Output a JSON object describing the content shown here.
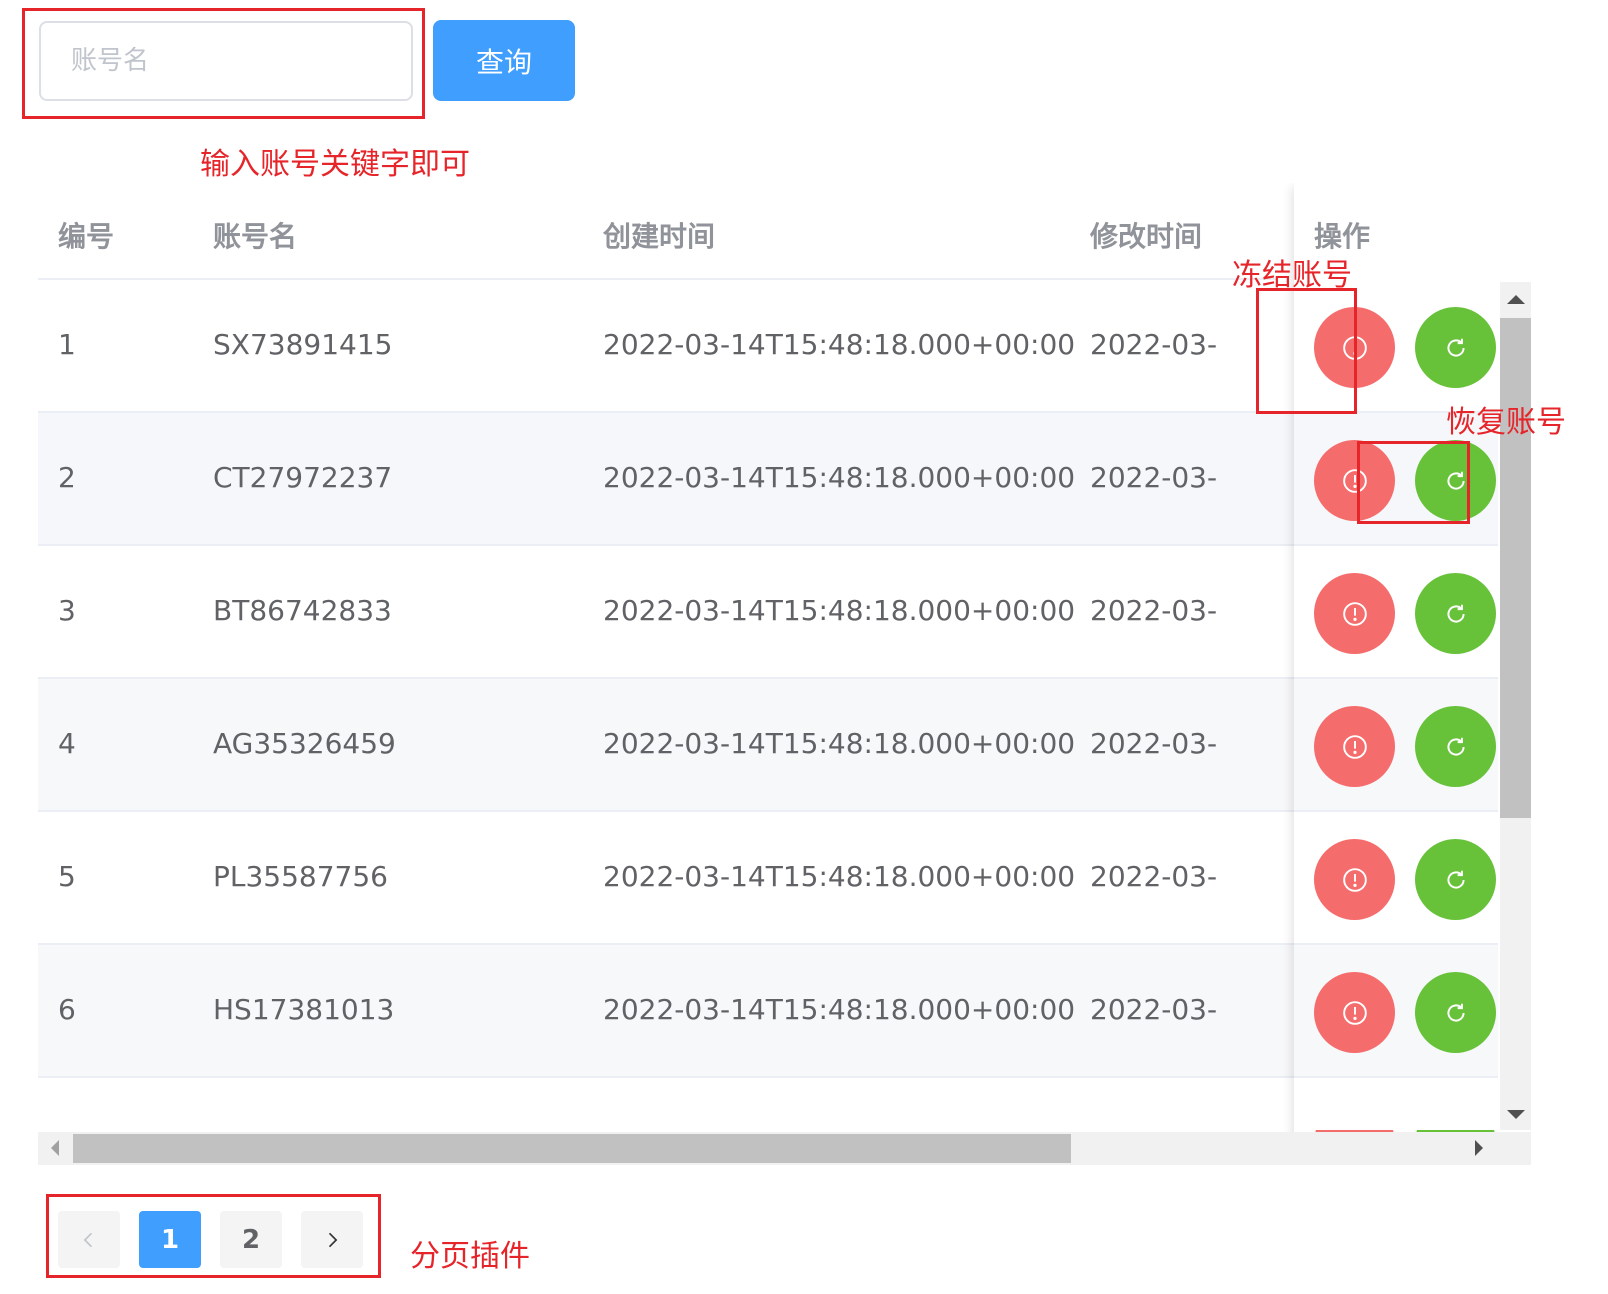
{
  "search": {
    "placeholder": "账号名",
    "value": "",
    "button_label": "查询"
  },
  "annotations": {
    "search_hint": "输入账号关键字即可",
    "freeze_hint": "冻结账号",
    "restore_hint": "恢复账号",
    "pagination_hint": "分页插件"
  },
  "table": {
    "columns": [
      "编号",
      "账号名",
      "创建时间",
      "修改时间",
      "操作"
    ],
    "rows": [
      {
        "id": "1",
        "account": "SX73891415",
        "created": "2022-03-14T15:48:18.000+00:00",
        "modified": "2022-03-"
      },
      {
        "id": "2",
        "account": "CT27972237",
        "created": "2022-03-14T15:48:18.000+00:00",
        "modified": "2022-03-"
      },
      {
        "id": "3",
        "account": "BT86742833",
        "created": "2022-03-14T15:48:18.000+00:00",
        "modified": "2022-03-"
      },
      {
        "id": "4",
        "account": "AG35326459",
        "created": "2022-03-14T15:48:18.000+00:00",
        "modified": "2022-03-"
      },
      {
        "id": "5",
        "account": "PL35587756",
        "created": "2022-03-14T15:48:18.000+00:00",
        "modified": "2022-03-"
      },
      {
        "id": "6",
        "account": "HS17381013",
        "created": "2022-03-14T15:48:18.000+00:00",
        "modified": "2022-03-"
      }
    ],
    "actions": {
      "freeze_icon": "warning-circle-icon",
      "restore_icon": "refresh-icon"
    }
  },
  "pagination": {
    "pages": [
      "1",
      "2"
    ],
    "current": "1",
    "prev_icon": "chevron-left-icon",
    "next_icon": "chevron-right-icon"
  },
  "colors": {
    "primary": "#409eff",
    "danger": "#f56c6c",
    "success": "#67c23a",
    "annotation": "#e6252a"
  }
}
